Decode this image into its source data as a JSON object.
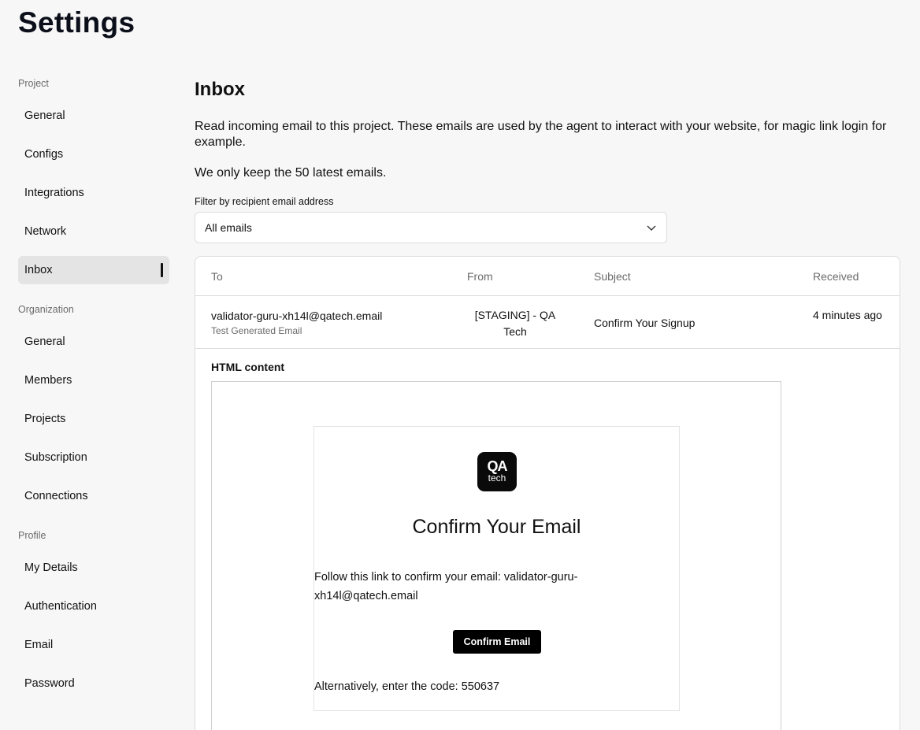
{
  "page": {
    "title": "Settings"
  },
  "sidebar": {
    "groups": [
      {
        "label": "Project",
        "items": [
          "General",
          "Configs",
          "Integrations",
          "Network",
          "Inbox"
        ]
      },
      {
        "label": "Organization",
        "items": [
          "General",
          "Members",
          "Projects",
          "Subscription",
          "Connections"
        ]
      },
      {
        "label": "Profile",
        "items": [
          "My Details",
          "Authentication",
          "Email",
          "Password"
        ]
      }
    ],
    "active_item": "Inbox"
  },
  "main": {
    "title": "Inbox",
    "description": "Read incoming email to this project. These emails are used by the agent to interact with your website, for magic link login for example.",
    "note": "We only keep the 50 latest emails.",
    "filter": {
      "label": "Filter by recipient email address",
      "value": "All emails",
      "icon": "chevron-down-icon"
    }
  },
  "table": {
    "columns": {
      "to": "To",
      "from": "From",
      "subject": "Subject",
      "received": "Received"
    },
    "rows": [
      {
        "to": "validator-guru-xh14l@qatech.email",
        "to_sub": "Test Generated Email",
        "from": "[STAGING] - QA Tech",
        "subject": "Confirm Your Signup",
        "received": "4 minutes ago"
      }
    ],
    "html_content_label": "HTML content"
  },
  "email_preview": {
    "logo_line1": "QA",
    "logo_line2": "tech",
    "heading": "Confirm Your Email",
    "body": "Follow this link to confirm your email: validator-guru-xh14l@qatech.email",
    "button": "Confirm Email",
    "code_text": "Alternatively, enter the code: 550637"
  }
}
